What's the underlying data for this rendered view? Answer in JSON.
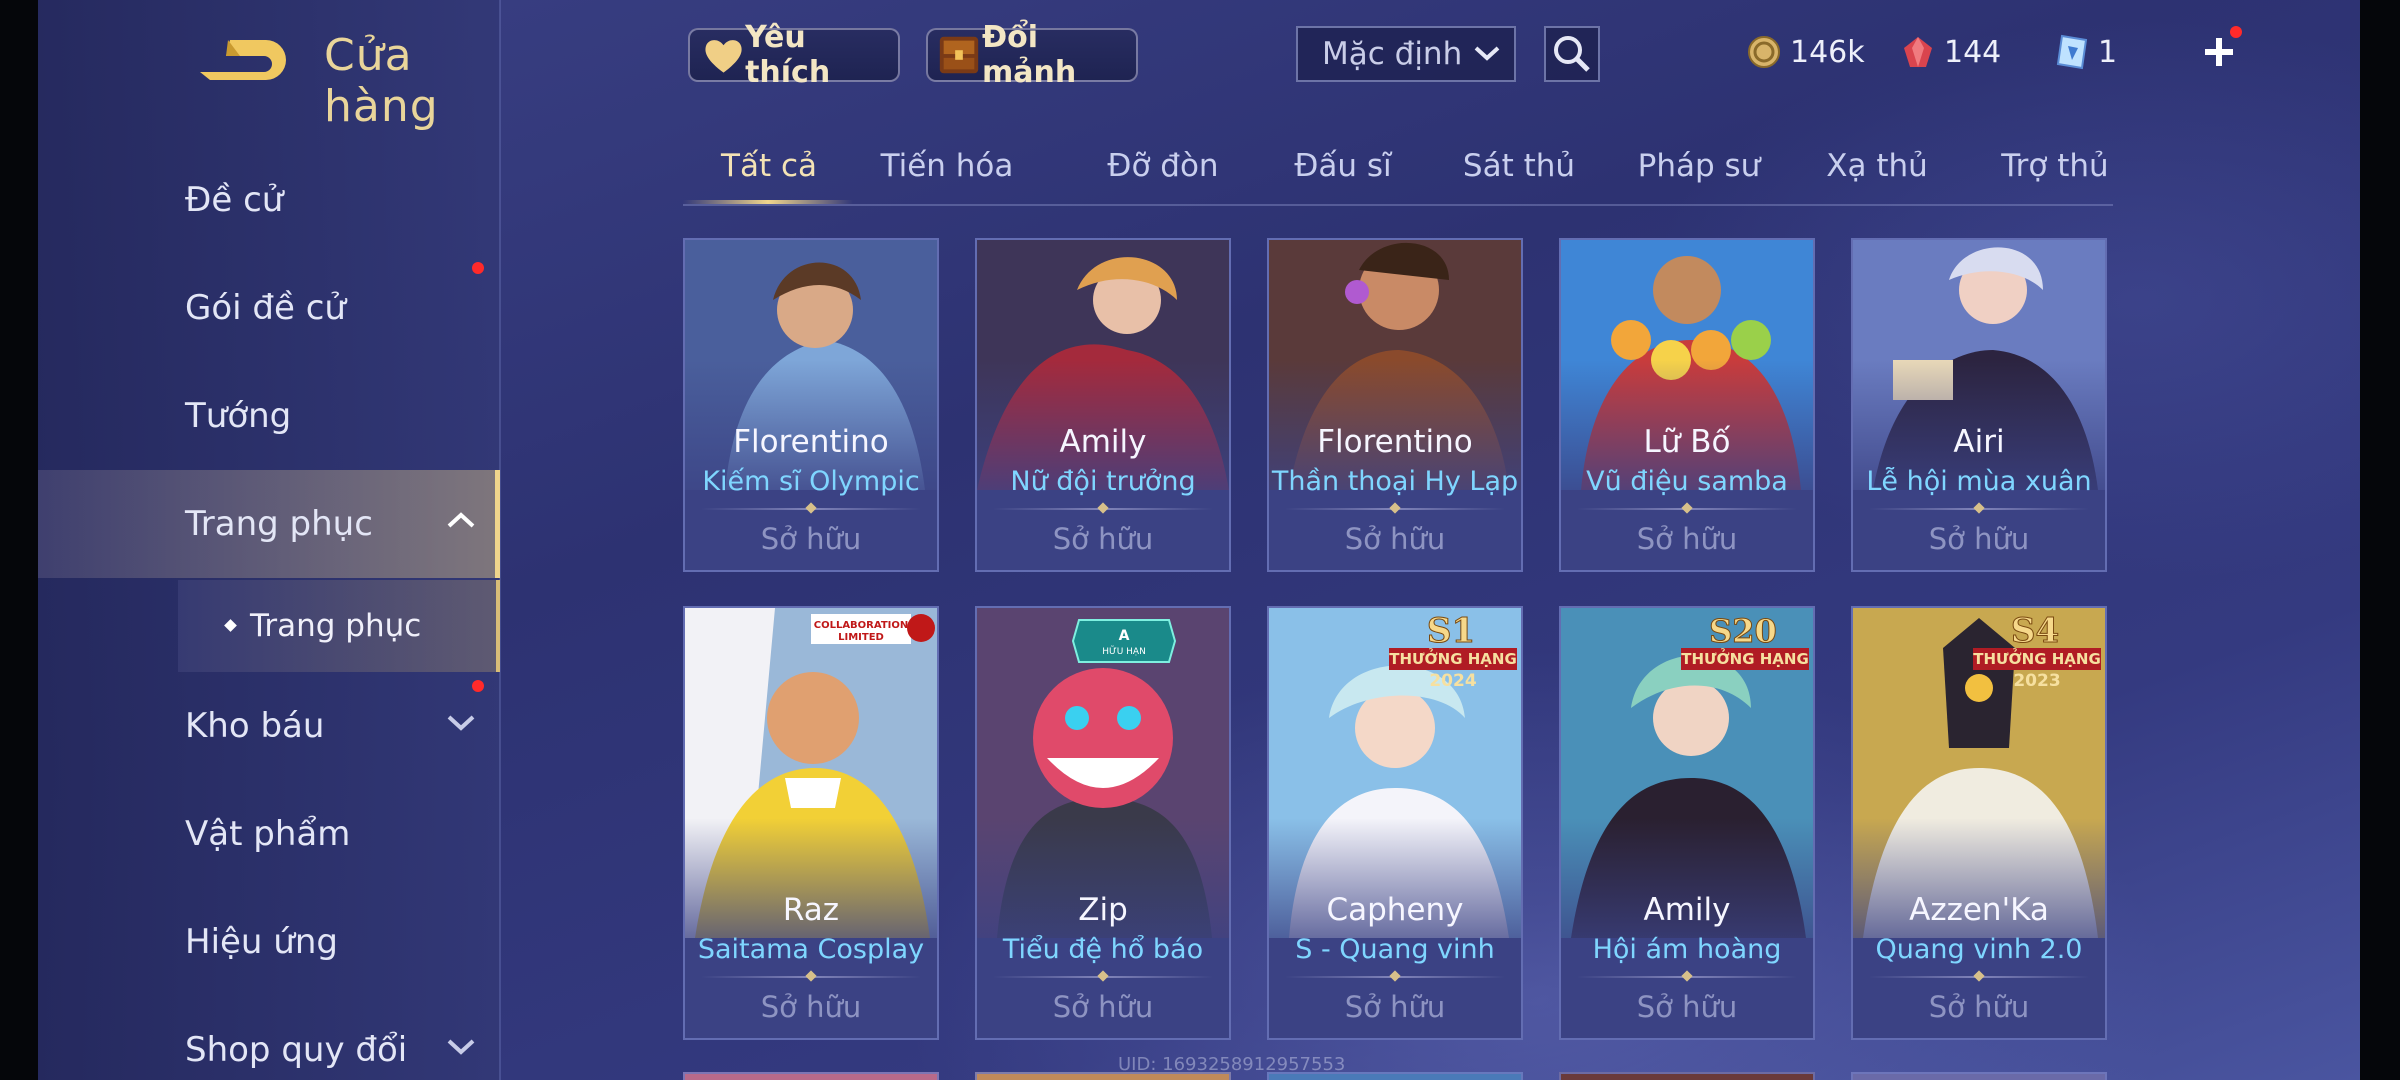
{
  "header": {
    "title": "Cửa hàng"
  },
  "sidebar": {
    "items": [
      {
        "label": "Đề cử"
      },
      {
        "label": "Gói đề cử"
      },
      {
        "label": "Tướng"
      },
      {
        "label": "Trang phục"
      },
      {
        "label": "Kho báu"
      },
      {
        "label": "Vật phẩm"
      },
      {
        "label": "Hiệu ứng"
      },
      {
        "label": "Shop quy đổi"
      }
    ],
    "sub_item": {
      "label": "Trang phục"
    }
  },
  "topbar": {
    "favorites_label": "Yêu thích",
    "exchange_label": "Đổi mảnh",
    "sort_value": "Mặc định",
    "gold": "146k",
    "gems": "144",
    "vouchers": "1"
  },
  "tabs": [
    "Tất cả",
    "Tiến hóa",
    "Đỡ đòn",
    "Đấu sĩ",
    "Sát thủ",
    "Pháp sư",
    "Xạ thủ",
    "Trợ thủ"
  ],
  "cards": [
    {
      "hero": "Florentino",
      "skin": "Kiếm sĩ Olympic",
      "status": "Sở hữu"
    },
    {
      "hero": "Amily",
      "skin": "Nữ đội trưởng",
      "status": "Sở hữu"
    },
    {
      "hero": "Florentino",
      "skin": "Thần thoại Hy Lạp",
      "status": "Sở hữu"
    },
    {
      "hero": "Lữ Bố",
      "skin": "Vũ điệu samba",
      "status": "Sở hữu"
    },
    {
      "hero": "Airi",
      "skin": "Lễ hội mùa xuân",
      "status": "Sở hữu"
    },
    {
      "hero": "Raz",
      "skin": "Saitama Cosplay",
      "status": "Sở hữu",
      "badge": "COLLABORATION LIMITED"
    },
    {
      "hero": "Zip",
      "skin": "Tiểu đệ hổ báo",
      "status": "Sở hữu",
      "badge": "A HỮU HẠN"
    },
    {
      "hero": "Capheny",
      "skin": "S - Quang vinh",
      "status": "Sở hữu",
      "badge": "S1 THƯỞNG HẠNG 2024"
    },
    {
      "hero": "Amily",
      "skin": "Hội ám hoàng",
      "status": "Sở hữu",
      "badge": "S20 THƯỞNG HẠNG"
    },
    {
      "hero": "Azzen'Ka",
      "skin": "Quang vinh 2.0",
      "status": "Sở hữu",
      "badge": "S4 THƯỞNG HẠNG 2023"
    }
  ],
  "uid": "UID: 1693258912957553",
  "colors": {
    "accent_gold": "#f0d58c",
    "skin_name": "#7fd6ff",
    "notify_dot": "#ff2a2a"
  }
}
